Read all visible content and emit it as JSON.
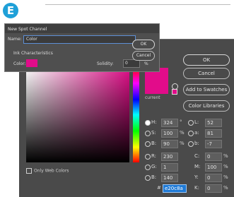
{
  "step_badge": "E",
  "spot_dialog": {
    "title": "New Spot Channel",
    "name_label": "Name:",
    "name_value": "Color",
    "ink_section": "Ink Characteristics",
    "color_label": "Color:",
    "solidity_label": "Solidity:",
    "solidity_value": "0",
    "solidity_unit": "%",
    "ok_label": "OK",
    "cancel_label": "Cancel"
  },
  "picker": {
    "ok_label": "OK",
    "cancel_label": "Cancel",
    "add_swatches_label": "Add to Swatches",
    "color_libraries_label": "Color Libraries",
    "current_label": "current",
    "only_web_colors": "Only Web Colors",
    "hash": "#",
    "hex_value": "e20c8a",
    "accent": "#e20c8a",
    "fields": [
      {
        "label": "H:",
        "value": "324",
        "unit": "°",
        "selected": true
      },
      {
        "label": "S:",
        "value": "100",
        "unit": "%",
        "selected": false
      },
      {
        "label": "B:",
        "value": "90",
        "unit": "%",
        "selected": false
      },
      {
        "label": "R:",
        "value": "230",
        "unit": "",
        "selected": false
      },
      {
        "label": "G:",
        "value": "1",
        "unit": "",
        "selected": false
      },
      {
        "label": "B:",
        "value": "140",
        "unit": "",
        "selected": false
      }
    ],
    "lab": [
      {
        "label": "L:",
        "value": "52"
      },
      {
        "label": "a:",
        "value": "81"
      },
      {
        "label": "b:",
        "value": "-7"
      }
    ],
    "cmyk": [
      {
        "label": "C:",
        "value": "0",
        "unit": "%"
      },
      {
        "label": "M:",
        "value": "100",
        "unit": "%"
      },
      {
        "label": "Y:",
        "value": "0",
        "unit": "%"
      },
      {
        "label": "K:",
        "value": "0",
        "unit": "%"
      }
    ]
  }
}
